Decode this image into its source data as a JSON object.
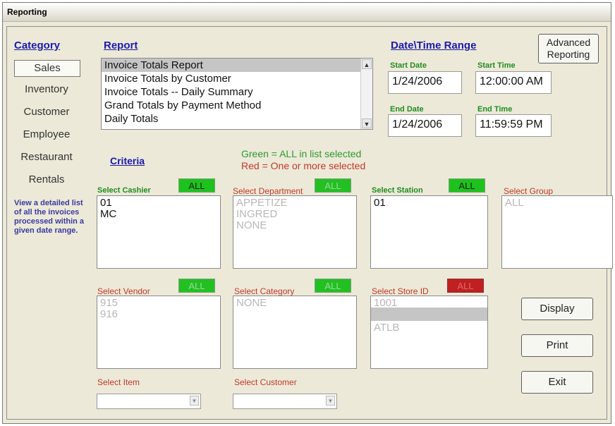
{
  "window": {
    "title": "Reporting"
  },
  "category": {
    "header": "Category",
    "items": [
      "Sales",
      "Inventory",
      "Customer",
      "Employee",
      "Restaurant",
      "Rentals"
    ],
    "selected": "Sales",
    "description": "View a detailed list of all the invoices processed within a given date range."
  },
  "report": {
    "header": "Report",
    "items": [
      "Invoice Totals Report",
      "Invoice Totals by Customer",
      "Invoice Totals -- Daily Summary",
      "Grand Totals by Payment Method",
      "Daily Totals"
    ],
    "selected": "Invoice Totals Report"
  },
  "date_range": {
    "header": "Date\\Time Range",
    "start_date_label": "Start Date",
    "start_date": "1/24/2006",
    "start_time_label": "Start Time",
    "start_time": "12:00:00 AM",
    "end_date_label": "End Date",
    "end_date": "1/24/2006",
    "end_time_label": "End Time",
    "end_time": "11:59:59 PM"
  },
  "advanced_button": {
    "line1": "Advanced",
    "line2": "Reporting"
  },
  "criteria": {
    "header": "Criteria",
    "legend_green": "Green = ALL in list selected",
    "legend_red": "Red = One or more selected"
  },
  "filters": {
    "cashier": {
      "label": "Select Cashier",
      "all": "ALL",
      "items": [
        "01",
        "MC"
      ]
    },
    "department": {
      "label": "Select Department",
      "all": "ALL",
      "items": [
        "APPETIZE",
        "INGRED",
        "NONE"
      ]
    },
    "station": {
      "label": "Select Station",
      "all": "ALL",
      "items": [
        "01"
      ]
    },
    "group": {
      "label": "Select Group",
      "items": [
        "ALL"
      ]
    },
    "vendor": {
      "label": "Select Vendor",
      "all": "ALL",
      "items": [
        "915",
        "916"
      ]
    },
    "category": {
      "label": "Select Category",
      "all": "ALL",
      "items": [
        "NONE"
      ]
    },
    "store": {
      "label": "Select Store ID",
      "all": "ALL",
      "items": [
        "1001",
        "",
        "ATLB"
      ]
    },
    "item": {
      "label": "Select Item"
    },
    "customer": {
      "label": "Select Customer"
    }
  },
  "buttons": {
    "display": "Display",
    "print": "Print",
    "exit": "Exit"
  },
  "colors": {
    "link_blue": "#1a1aa8",
    "green": "#1ec21e",
    "red": "#c02020"
  }
}
